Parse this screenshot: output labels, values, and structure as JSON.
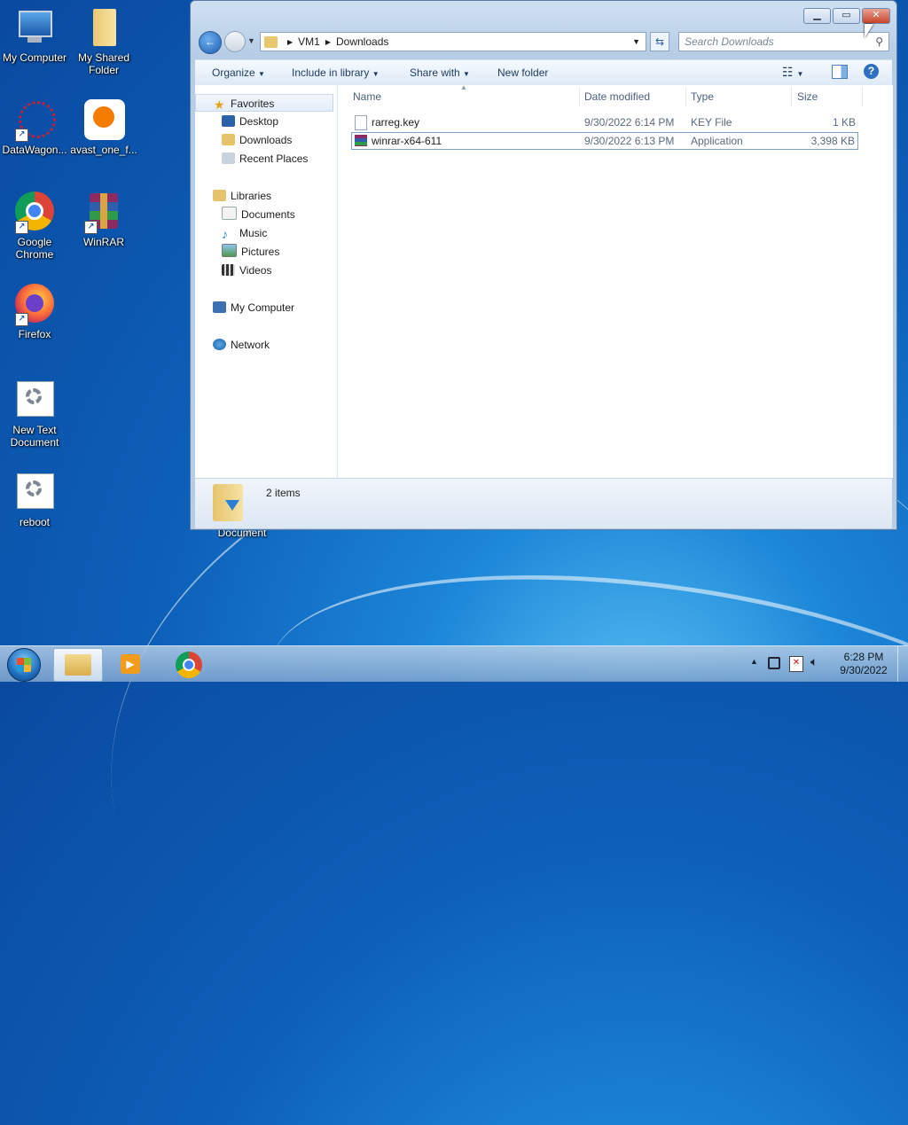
{
  "desktop": {
    "icons": [
      {
        "label": "My Computer"
      },
      {
        "label": "My Shared Folder"
      },
      {
        "label": "DataWagon..."
      },
      {
        "label": "avast_one_f..."
      },
      {
        "label": "Google Chrome"
      },
      {
        "label": "WinRAR"
      },
      {
        "label": "Firefox"
      },
      {
        "label": "New Text Document"
      },
      {
        "label": "reboot"
      }
    ],
    "partial_label": "Document"
  },
  "window": {
    "address": {
      "root": "VM1",
      "folder": "Downloads"
    },
    "search_placeholder": "Search Downloads",
    "toolbar": {
      "organize": "Organize",
      "include": "Include in library",
      "share": "Share with",
      "new_folder": "New folder"
    },
    "nav": {
      "favorites": "Favorites",
      "desktop": "Desktop",
      "downloads": "Downloads",
      "recent": "Recent Places",
      "libraries": "Libraries",
      "documents": "Documents",
      "music": "Music",
      "pictures": "Pictures",
      "videos": "Videos",
      "computer": "My Computer",
      "network": "Network"
    },
    "columns": {
      "name": "Name",
      "date": "Date modified",
      "type": "Type",
      "size": "Size"
    },
    "files": [
      {
        "name": "rarreg.key",
        "date": "9/30/2022 6:14 PM",
        "type": "KEY File",
        "size": "1 KB"
      },
      {
        "name": "winrar-x64-611",
        "date": "9/30/2022 6:13 PM",
        "type": "Application",
        "size": "3,398 KB"
      }
    ],
    "status": "2 items"
  },
  "taskbar": {
    "time": "6:28 PM",
    "date": "9/30/2022"
  }
}
